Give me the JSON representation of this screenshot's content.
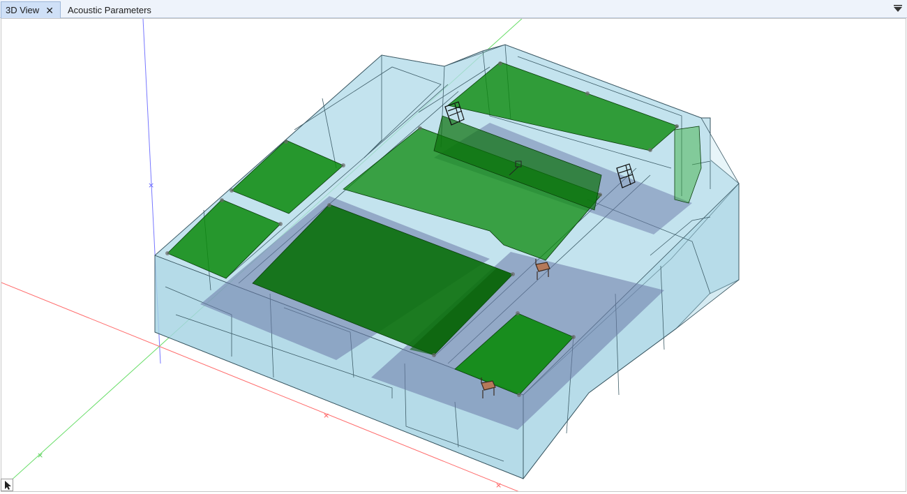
{
  "tabs": [
    {
      "label": "3D View",
      "active": true
    },
    {
      "label": "Acoustic Parameters",
      "active": false
    }
  ],
  "icons": {
    "tab_close": "close-icon",
    "tab_menu": "triangle-down-icon",
    "tool": "cursor-arrow-icon"
  },
  "colors": {
    "room_fill": "#a9d6e5",
    "room_edge": "#33505c",
    "absorber_green": "#0b7d0b",
    "floor_blue": "#6c7aa8",
    "axis_x": "#ff5555",
    "axis_y": "#55cc55",
    "axis_z": "#6666ff"
  }
}
